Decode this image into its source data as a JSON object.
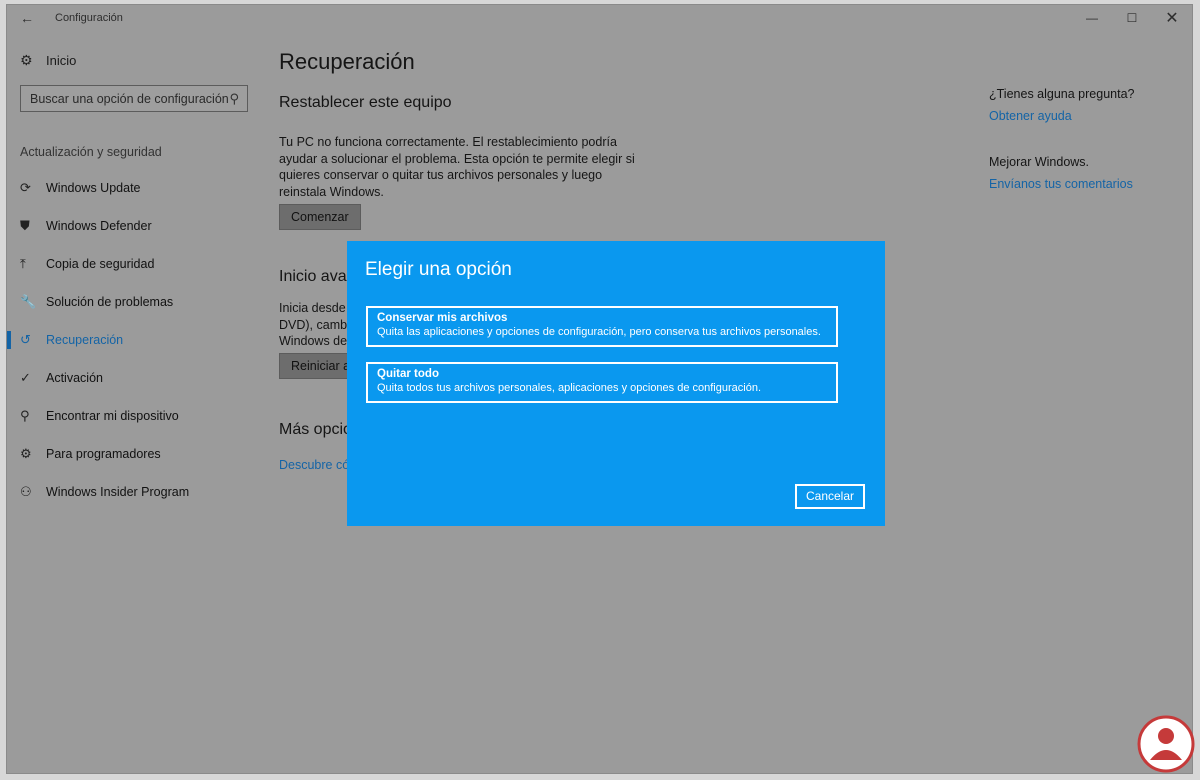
{
  "window": {
    "title": "Configuración",
    "back_icon": "←",
    "minimize_icon": "—",
    "maximize_icon": "☐",
    "close_icon": "✕"
  },
  "sidebar": {
    "home_label": "Inicio",
    "search_placeholder": "Buscar una opción de configuración",
    "section_label": "Actualización y seguridad",
    "items": [
      {
        "label": "Windows Update",
        "icon": "refresh-icon",
        "glyph": "⟳",
        "active": false
      },
      {
        "label": "Windows Defender",
        "icon": "shield-icon",
        "glyph": "⛊",
        "active": false
      },
      {
        "label": "Copia de seguridad",
        "icon": "backup-icon",
        "glyph": "⤒",
        "active": false
      },
      {
        "label": "Solución de problemas",
        "icon": "wrench-icon",
        "glyph": "🔧",
        "active": false
      },
      {
        "label": "Recuperación",
        "icon": "history-icon",
        "glyph": "↺",
        "active": true
      },
      {
        "label": "Activación",
        "icon": "check-circle-icon",
        "glyph": "✓",
        "active": false
      },
      {
        "label": "Encontrar mi dispositivo",
        "icon": "person-location-icon",
        "glyph": "⚲",
        "active": false
      },
      {
        "label": "Para programadores",
        "icon": "developer-icon",
        "glyph": "⚙",
        "active": false
      },
      {
        "label": "Windows Insider Program",
        "icon": "insider-icon",
        "glyph": "⚇",
        "active": false
      }
    ]
  },
  "main": {
    "title": "Recuperación",
    "reset": {
      "heading": "Restablecer este equipo",
      "description": "Tu PC no funciona correctamente. El restablecimiento podría ayudar a solucionar el problema. Esta opción te permite elegir si quieres conservar o quitar tus archivos personales y luego reinstala Windows.",
      "button": "Comenzar"
    },
    "advanced": {
      "heading": "Inicio avar",
      "description": "Inicia desde u\nDVD), cambia\nWindows des",
      "button": "Reiniciar ah"
    },
    "more": {
      "heading": "Más opcio",
      "link": "Descubre cóm"
    }
  },
  "right_panel": {
    "question": "¿Tienes alguna pregunta?",
    "help_link": "Obtener ayuda",
    "improve": "Mejorar Windows.",
    "feedback_link": "Envíanos tus comentarios"
  },
  "dialog": {
    "title": "Elegir una opción",
    "options": [
      {
        "title": "Conservar mis archivos",
        "description": "Quita las aplicaciones y opciones de configuración, pero conserva tus archivos personales."
      },
      {
        "title": "Quitar todo",
        "description": "Quita todos tus archivos personales, aplicaciones y opciones de configuración."
      }
    ],
    "cancel": "Cancelar"
  },
  "colors": {
    "dialog_bg": "#0a98ef",
    "accent": "#1464a6",
    "overlay_gray": "#9b9b9b"
  }
}
